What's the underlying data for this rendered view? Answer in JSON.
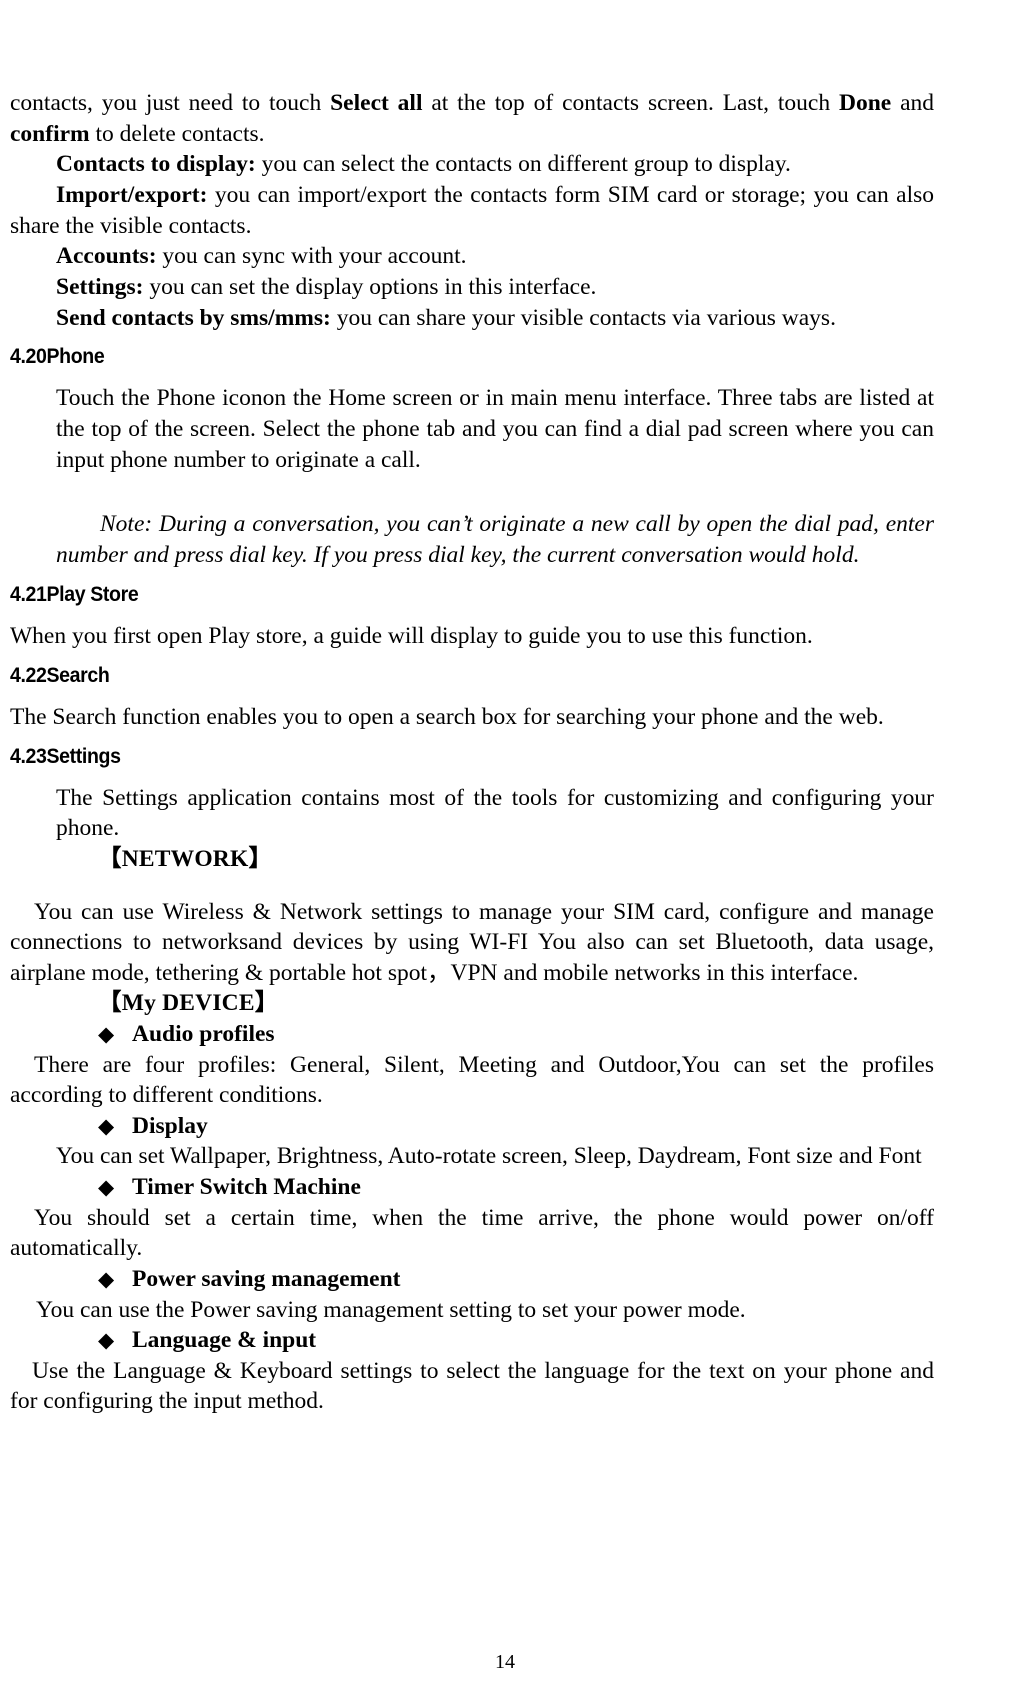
{
  "document": {
    "page_number": "14"
  },
  "top_paragraph": {
    "part1": "contacts, you just need to touch ",
    "bold1": "Select all",
    "part2": " at the top of contacts screen. Last, touch ",
    "bold2": "Done",
    "part3": " and ",
    "bold3": "confirm",
    "part4": " to delete contacts."
  },
  "contact_options": [
    {
      "label": "Contacts to display:",
      "text": " you can select the contacts on different group to display."
    },
    {
      "label": "Import/export:",
      "text": " you can import/export the contacts form SIM card or storage; you can also share the visible contacts."
    },
    {
      "label": "Accounts:",
      "text": " you can sync with your account."
    },
    {
      "label": "Settings:",
      "text": " you can set the display options in this interface."
    },
    {
      "label": "Send contacts by sms/mms:",
      "text": " you can share your visible contacts via various ways."
    }
  ],
  "sections": {
    "phone": {
      "heading": "4.20Phone",
      "body": "Touch the Phone iconon the Home screen or in main menu interface. Three tabs are listed at the top of the screen. Select the phone tab and you can find a dial pad screen where you can input phone number to originate a call.",
      "note": "Note: During a conversation, you can’t originate a new call by open the dial pad, enter number and press dial key. If you press dial key, the current conversation would hold."
    },
    "play_store": {
      "heading": "4.21Play Store",
      "body": "When you first open  Play store, a guide will display to guide you to use this function."
    },
    "search": {
      "heading": "4.22Search",
      "body": "The Search function enables you to open a search box for searching your phone and the web."
    },
    "settings": {
      "heading": "4.23Settings",
      "body": "The Settings application contains most of the tools for customizing and configuring your phone.",
      "network_group": {
        "title": "【NETWORK】",
        "body": "You can use Wireless & Network settings to manage your SIM card, configure and manage connections to networksand devices by using WI-FI You also can set Bluetooth, data usage, airplane mode, tethering & portable hot spot，VPN and mobile networks in this interface."
      },
      "device_group": {
        "title": "【My DEVICE】",
        "items": [
          {
            "bullet": "diamond-bullet",
            "label": "Audio profiles",
            "body": "There are four profiles: General, Silent, Meeting and Outdoor,You can set the profiles according to different conditions."
          },
          {
            "bullet": "diamond-bullet",
            "label": "Display",
            "body": "You can set Wallpaper, Brightness, Auto-rotate screen, Sleep, Daydream, Font size and Font"
          },
          {
            "bullet": "diamond-bullet",
            "label": "Timer Switch Machine",
            "body": "You should set a certain time, when the time arrive, the phone would power on/off automatically."
          },
          {
            "bullet": "diamond-bullet",
            "label": "Power saving management",
            "body": "You can use the Power saving management setting to set your power mode."
          },
          {
            "bullet": "diamond-bullet",
            "label": "Language & input",
            "body": "Use the Language & Keyboard settings to select the language for the text on your phone and for configuring the input method."
          }
        ]
      }
    }
  },
  "glyphs": {
    "diamond": "◆"
  }
}
